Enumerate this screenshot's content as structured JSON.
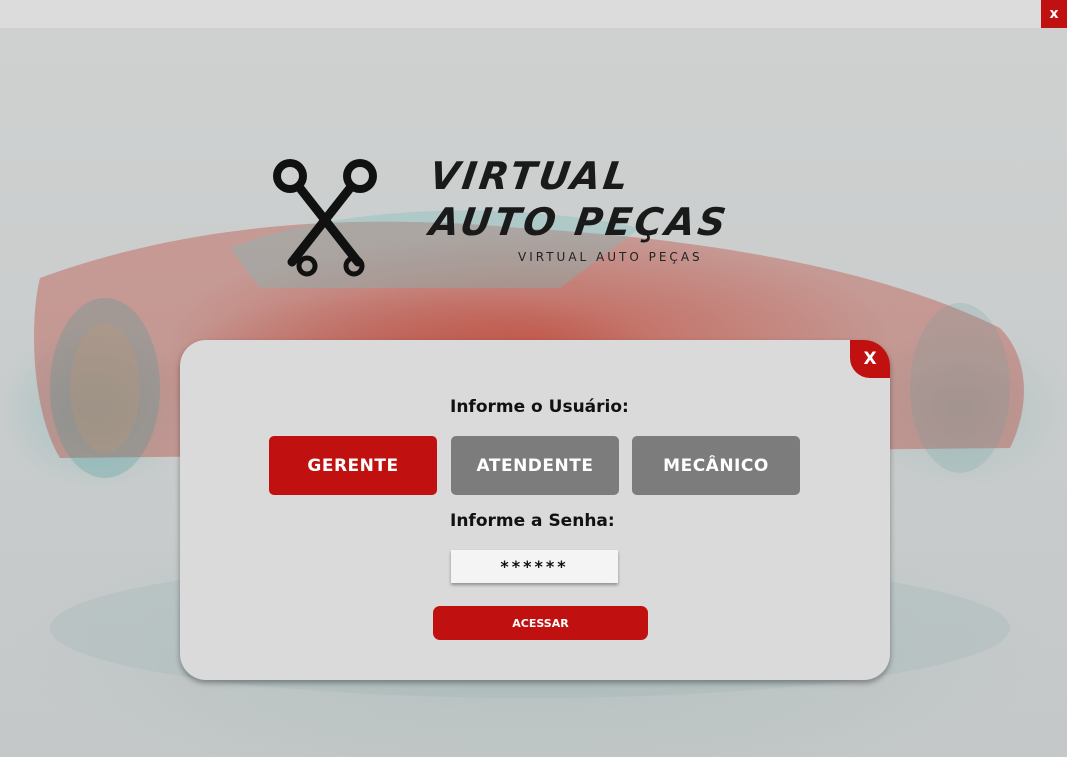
{
  "window": {
    "close_label": "x"
  },
  "logo": {
    "line1": "VIRTUAL",
    "line2": "AUTO PEÇAS",
    "subtitle": "VIRTUAL AUTO PEÇAS",
    "icon": "crossed-pistons-icon"
  },
  "login": {
    "close_label": "X",
    "user_label": "Informe o Usuário:",
    "roles": [
      "GERENTE",
      "ATENDENTE",
      "MECÂNICO"
    ],
    "selected_role": "GERENTE",
    "password_label": "Informe a Senha:",
    "password_value": "******",
    "access_label": "ACESSAR"
  },
  "colors": {
    "accent": "#c0100f",
    "role_inactive": "#7c7c7c",
    "modal_bg": "#dadada",
    "topbar_bg": "#dcdcdc"
  }
}
